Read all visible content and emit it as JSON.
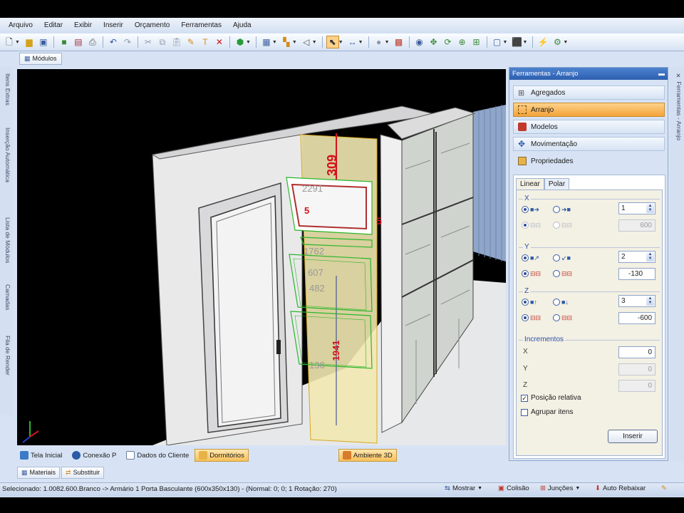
{
  "menu": [
    "Arquivo",
    "Editar",
    "Exibir",
    "Inserir",
    "Orçamento",
    "Ferramentas",
    "Ajuda"
  ],
  "doc_tab": "Módulos",
  "left_sidebar": [
    "Itens Extras",
    "Inserção Automática",
    "Lista de Módulos",
    "Camadas",
    "Fila de Render"
  ],
  "right_sidebar": "Ferramentas - Arranjo",
  "viewport_labels": {
    "dim_top": "309",
    "dim_height": "1941",
    "label_2291": "2291",
    "label_1762": "1762",
    "label_607": "607",
    "label_482": "482",
    "label_136": "136",
    "label_5a": "5",
    "label_5b": "5"
  },
  "bottom_tabs": [
    {
      "label": "Tela Inicial",
      "active": false
    },
    {
      "label": "Conexão P",
      "active": false
    },
    {
      "label": "Dados do Cliente",
      "active": false
    },
    {
      "label": "Dormitórios",
      "active": true
    },
    {
      "label": "Ambiente 3D",
      "active": true
    }
  ],
  "bottom_tabs2": [
    "Materiais",
    "Substituir"
  ],
  "panel": {
    "title": "Ferramentas - Arranjo",
    "accordion": [
      {
        "label": "Agregados",
        "active": false
      },
      {
        "label": "Arranjo",
        "active": true
      },
      {
        "label": "Modelos",
        "active": false
      },
      {
        "label": "Movimentação",
        "active": false
      },
      {
        "label": "Propriedades",
        "active": false
      }
    ],
    "tabs": [
      "Linear",
      "Polar"
    ],
    "active_tab": "Linear",
    "x": {
      "label": "X",
      "count": "1",
      "offset": "600"
    },
    "y": {
      "label": "Y",
      "count": "2",
      "offset": "-130"
    },
    "z": {
      "label": "Z",
      "count": "3",
      "offset": "-600"
    },
    "increments": {
      "label": "Incrementos",
      "x_label": "X",
      "x_value": "0",
      "y_label": "Y",
      "y_value": "0",
      "z_label": "Z",
      "z_value": "0"
    },
    "relative_position": "Posição relativa",
    "group_items": "Agrupar itens",
    "insert_button": "Inserir"
  },
  "status": {
    "text": "Selecionado: 1.0082.600.Branco -> Armário 1 Porta Basculante (600x350x130) - (Normal: 0; 0; 1 Rotação: 270)",
    "show": "Mostrar",
    "collision": "Colisão",
    "joints": "Junções",
    "auto_lower": "Auto Rebaixar"
  },
  "colors": {
    "accent": "#f3a33a",
    "panel_header": "#2d5fb0",
    "dimension": "#d3101a",
    "selection": "#2bb52b"
  }
}
